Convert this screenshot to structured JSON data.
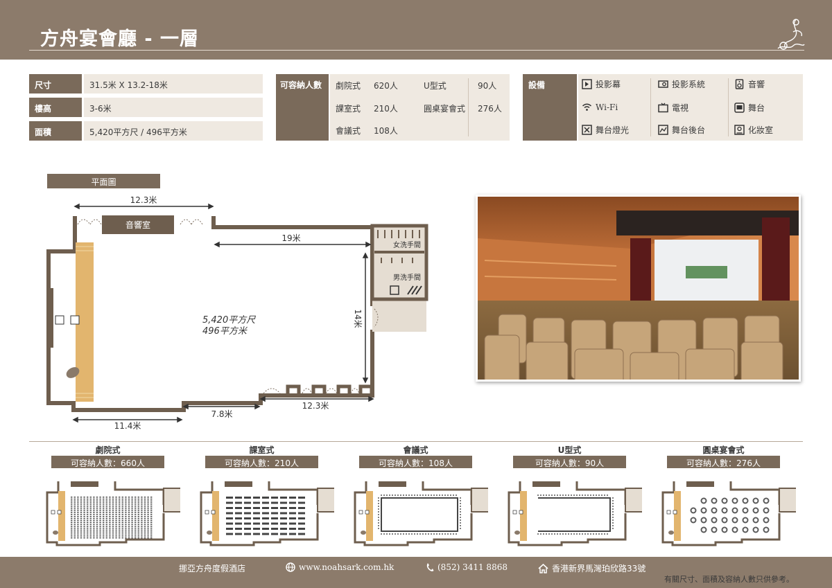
{
  "header": {
    "title": "方舟宴會廳 - 一層"
  },
  "specs": [
    {
      "label": "尺寸",
      "value": "31.5米 X 13.2-18米"
    },
    {
      "label": "樓高",
      "value": "3-6米"
    },
    {
      "label": "面積",
      "value": "5,420平方尺 / 496平方米"
    }
  ],
  "capacity": {
    "label": "可容納人數",
    "items": [
      {
        "name": "劇院式",
        "value": "620人"
      },
      {
        "name": "課室式",
        "value": "210人"
      },
      {
        "name": "會議式",
        "value": "108人"
      },
      {
        "name": "U型式",
        "value": "90人"
      },
      {
        "name": "圓桌宴會式",
        "value": "276人"
      }
    ]
  },
  "equipment": {
    "label": "設備",
    "items": [
      {
        "name": "投影幕",
        "icon": "projection-screen-icon"
      },
      {
        "name": "投影系統",
        "icon": "projector-icon"
      },
      {
        "name": "音響",
        "icon": "speaker-icon"
      },
      {
        "name": "Wi-Fi",
        "icon": "wifi-icon"
      },
      {
        "name": "電視",
        "icon": "tv-icon"
      },
      {
        "name": "舞台",
        "icon": "stage-icon"
      },
      {
        "name": "舞台燈光",
        "icon": "stage-light-icon"
      },
      {
        "name": "舞台後台",
        "icon": "backstage-icon"
      },
      {
        "name": "化妝室",
        "icon": "dressing-room-icon"
      }
    ]
  },
  "floorplan": {
    "label": "平面圖",
    "dim_top": "12.3米",
    "dim_inner": "19米",
    "dim_right": "14米",
    "dim_bottom_right": "12.3米",
    "dim_bottom_mid": "7.8米",
    "dim_bottom_left": "11.4米",
    "area_sqft": "5,420平方尺",
    "area_sqm": "496平方米",
    "sound_room": "音響室",
    "ladies": "女洗手間",
    "gents": "男洗手間"
  },
  "layouts": [
    {
      "name": "劇院式",
      "capacity": "可容納人數：660人",
      "kind": "theatre"
    },
    {
      "name": "課室式",
      "capacity": "可容納人數：210人",
      "kind": "classroom"
    },
    {
      "name": "會議式",
      "capacity": "可容納人數：108人",
      "kind": "boardroom"
    },
    {
      "name": "U型式",
      "capacity": "可容納人數：90人",
      "kind": "ushape"
    },
    {
      "name": "圓桌宴會式",
      "capacity": "可容納人數：276人",
      "kind": "banquet"
    }
  ],
  "footer": {
    "hotel": "挪亞方舟度假酒店",
    "website": "www.noahsark.com.hk",
    "phone": "(852) 3411 8868",
    "address": "香港新界馬灣珀欣路33號",
    "note": "有關尺寸、面積及容納人數只供參考。"
  },
  "colors": {
    "brand": "#8c7b6b",
    "dark": "#7a6a5a",
    "light": "#efe9e1",
    "stage": "#e2b56e"
  }
}
